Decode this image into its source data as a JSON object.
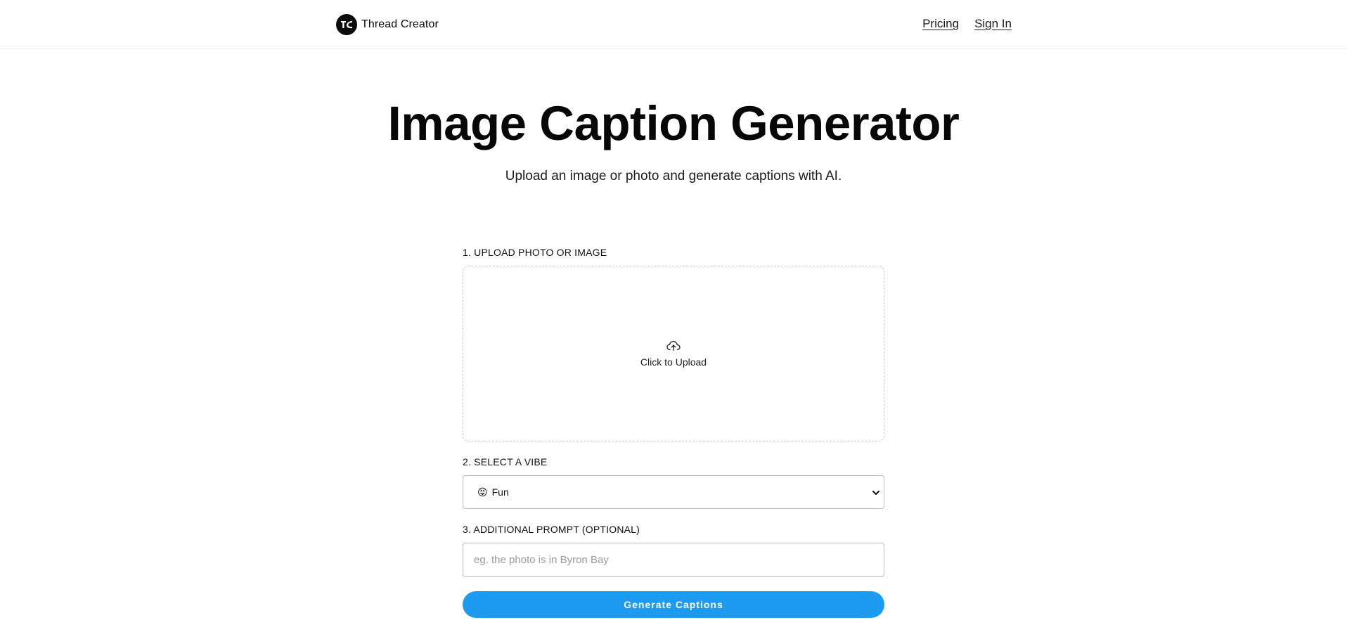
{
  "header": {
    "brand_name": "Thread Creator",
    "logo_icon": "thread-creator-logo-icon",
    "nav": {
      "pricing": "Pricing",
      "sign_in": "Sign In"
    }
  },
  "hero": {
    "title": "Image Caption Generator",
    "subtitle": "Upload an image or photo and generate captions with AI."
  },
  "form": {
    "step1_label": "1. UPLOAD PHOTO OR IMAGE",
    "upload_icon": "cloud-upload-icon",
    "upload_text": "Click to Upload",
    "step2_label": "2. SELECT A VIBE",
    "vibe_emoji": "😝",
    "vibe_selected": "Fun",
    "step3_label": "3. ADDITIONAL PROMPT (OPTIONAL)",
    "prompt_placeholder": "eg. the photo is in Byron Bay",
    "prompt_value": "",
    "generate_label": "Generate Captions"
  },
  "colors": {
    "accent": "#1d9bf0",
    "text": "#0b0b0b",
    "border": "#bdbdbd"
  }
}
